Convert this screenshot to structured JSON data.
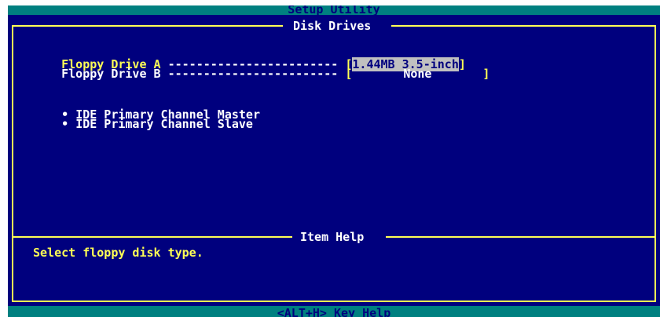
{
  "header": {
    "title": "Setup Utility"
  },
  "panel": {
    "title": "Disk Drives"
  },
  "settings": [
    {
      "label": "Floppy Drive A",
      "dashes": "------------------------",
      "value": "1.44MB 3.5-inch",
      "selected": true
    },
    {
      "label": "Floppy Drive B",
      "dashes": "------------------------",
      "value": "None",
      "selected": false
    }
  ],
  "submenus": [
    {
      "bullet": "•",
      "label": "IDE Primary Channel Master"
    },
    {
      "bullet": "•",
      "label": "IDE Primary Channel Slave"
    }
  ],
  "help_panel": {
    "title": "Item Help",
    "text": "Select floppy disk type."
  },
  "footer": {
    "hint": "<ALT+H>  Key Help"
  },
  "colors": {
    "background": "#00007e",
    "bar": "#008080",
    "highlight_text": "#ffff55",
    "text": "#ffffff",
    "selection": "#c0c0c0"
  }
}
